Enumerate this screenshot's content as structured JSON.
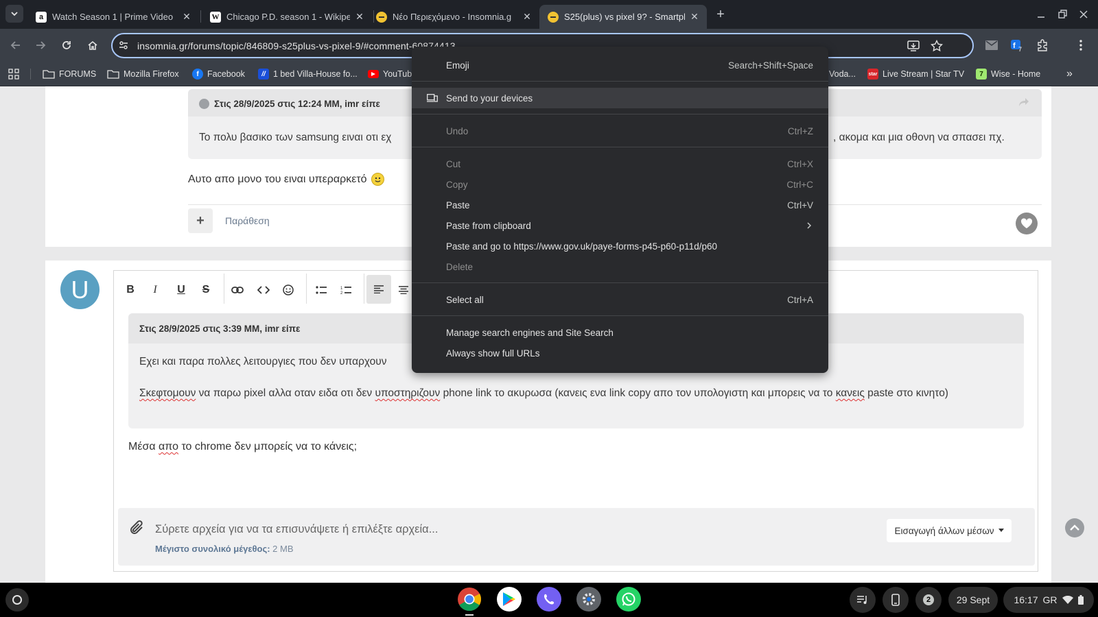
{
  "browser": {
    "tabs": [
      {
        "title": "Watch Season 1 | Prime Video",
        "favicon": "amazon-icon"
      },
      {
        "title": "Chicago P.D. season 1 - Wikipe",
        "favicon": "wikipedia-icon"
      },
      {
        "title": "Νέο Περιεχόμενο - Insomnia.g",
        "favicon": "insomnia-icon"
      },
      {
        "title": "S25(plus) vs pixel 9? - Smartph",
        "favicon": "insomnia-icon",
        "active": true
      }
    ],
    "url": "insomnia.gr/forums/topic/846809-s25plus-vs-pixel-9/#comment-60874413",
    "extension_badge": "7",
    "bookmarks": [
      {
        "label": "FORUMS",
        "icon": "folder-icon"
      },
      {
        "label": "Mozilla Firefox",
        "icon": "folder-icon"
      },
      {
        "label": "Facebook",
        "icon": "facebook-icon"
      },
      {
        "label": "1 bed Villa-House fo...",
        "icon": "booking-icon"
      },
      {
        "label": "YouTub",
        "icon": "youtube-icon"
      },
      {
        "label": "Voda...",
        "icon": "vodafone-icon"
      },
      {
        "label": "Live Stream | Star TV",
        "icon": "star-tv-icon"
      },
      {
        "label": "Wise - Home",
        "icon": "wise-icon"
      }
    ]
  },
  "post1": {
    "quote_header": "Στις 28/9/2025 στις 12:24 ΜΜ, imr είπε",
    "quote_text_start": "Το πολυ βασικο των samsung ειναι οτι εχ",
    "quote_text_end": ", ακομα και μια οθονη να σπασει πχ.",
    "reply_text": "Αυτο απο μονο του ειναι υπεραρκετό",
    "plus_label": "+",
    "quote_action": "Παράθεση"
  },
  "editor": {
    "avatar_letter": "U",
    "quote_header": "Στις 28/9/2025 στις 3:39 ΜΜ, imr είπε",
    "quote_p1_start": "Εχει και παρα πολλες λειτουργιες που δεν υπαρχουν",
    "quote_p1_end": ")",
    "quote_p2": [
      {
        "text": "Σκεφτομουν",
        "spell": true
      },
      {
        "text": " να παρω pixel αλλα οταν ειδα οτι δεν "
      },
      {
        "text": "υποστηριζουν",
        "spell": true
      },
      {
        "text": " phone link το ακυρωσα (κανεις ενα link copy απο τον υπολογιστη και μπορεις να το "
      },
      {
        "text": "κανεις",
        "spell": true
      },
      {
        "text": " paste στο κινητο)"
      }
    ],
    "new_text": [
      {
        "text": "Μέσα "
      },
      {
        "text": "απο",
        "spell": true
      },
      {
        "text": " το chrome δεν μπορείς να το κάνεις;"
      }
    ],
    "attach_text": "Σύρετε αρχεία για να τα επισυνάψετε ή επιλέξτε αρχεία...",
    "max_size_label": "Μέγιστο συνολικό μέγεθος:",
    "max_size_value": "2 MB",
    "insert_media": "Εισαγωγή άλλων μέσων"
  },
  "context_menu": {
    "emoji": {
      "label": "Emoji",
      "shortcut": "Search+Shift+Space"
    },
    "send": {
      "label": "Send to your devices"
    },
    "undo": {
      "label": "Undo",
      "shortcut": "Ctrl+Z"
    },
    "cut": {
      "label": "Cut",
      "shortcut": "Ctrl+X"
    },
    "copy": {
      "label": "Copy",
      "shortcut": "Ctrl+C"
    },
    "paste": {
      "label": "Paste",
      "shortcut": "Ctrl+V"
    },
    "paste_clipboard": {
      "label": "Paste from clipboard"
    },
    "paste_go": {
      "label": "Paste and go to https://www.gov.uk/paye-forms-p45-p60-p11d/p60"
    },
    "delete": {
      "label": "Delete"
    },
    "select_all": {
      "label": "Select all",
      "shortcut": "Ctrl+A"
    },
    "manage": {
      "label": "Manage search engines and Site Search"
    },
    "full_urls": {
      "label": "Always show full URLs"
    }
  },
  "shelf": {
    "apps": [
      "chrome-icon",
      "play-store-icon",
      "viber-icon",
      "settings-icon",
      "whatsapp-icon"
    ],
    "notification_count": "2",
    "date": "29 Sept",
    "time": "16:17",
    "locale": "GR"
  },
  "colors": {
    "accent": "#a8c7fa",
    "menu_bg": "#292a2d",
    "avatar": "#5aa0c2"
  }
}
